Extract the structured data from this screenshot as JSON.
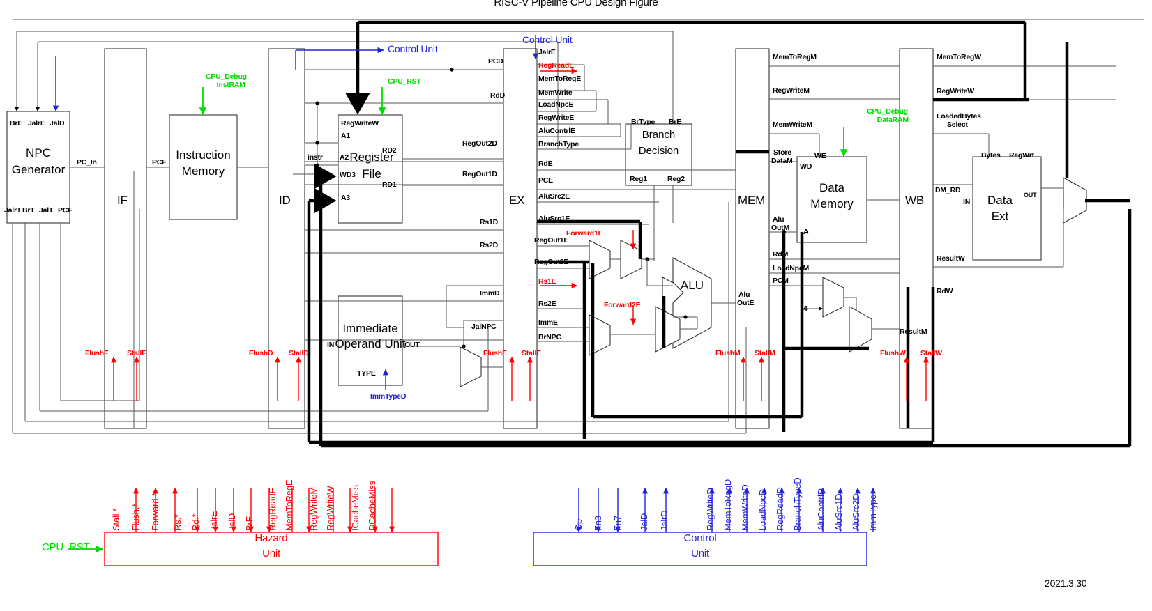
{
  "figure": {
    "title": "RISC-V Pipeline CPU Design Figure",
    "date": "2021.3.30"
  },
  "colors": {
    "black": "#000000",
    "red": "#ff0000",
    "blue": "#2222dd",
    "green": "#00dd00"
  },
  "stages": [
    {
      "name": "IF",
      "label": "IF"
    },
    {
      "name": "ID",
      "label": "ID"
    },
    {
      "name": "EX",
      "label": "EX"
    },
    {
      "name": "MEM",
      "label": "MEM"
    },
    {
      "name": "WB",
      "label": "WB"
    }
  ],
  "blocks": {
    "npc": {
      "line1": "NPC",
      "line2": "Generator"
    },
    "imem": {
      "line1": "Instruction",
      "line2": "Memory"
    },
    "regfile": {
      "line1": "Register",
      "line2": "File"
    },
    "imm": {
      "line1": "Immediate",
      "line2": "Operand Unit"
    },
    "branch": {
      "line1": "Branch",
      "line2": "Decision"
    },
    "alu": {
      "label": "ALU"
    },
    "dmem": {
      "line1": "Data",
      "line2": "Memory"
    },
    "dataext": {
      "line1": "Data",
      "line2": "Ext"
    },
    "hazard": {
      "line1": "Hazard",
      "line2": "Unit"
    },
    "control": {
      "line1": "Control",
      "line2": "Unit"
    }
  },
  "ports": {
    "npc_in": [
      "BrE",
      "JalrE",
      "JalD"
    ],
    "npc_out": [
      "JalrT",
      "BrT",
      "JalT",
      "PCF"
    ],
    "npc_pc_in": "PC_In",
    "if_pcf": "PCF",
    "regfile": {
      "regwritew": "RegWriteW",
      "a1": "A1",
      "a2": "A2",
      "wd3": "WD3",
      "a3": "A3",
      "rd1": "RD1",
      "rd2": "RD2"
    },
    "imm_in": "IN",
    "imm_out": "OUT",
    "imm_type_port": "TYPE",
    "branch": {
      "brtype": "BrType",
      "bre": "BrE",
      "reg1": "Reg1",
      "reg2": "Reg2"
    },
    "dmem": {
      "we": "WE",
      "wd": "WD",
      "a": "A"
    },
    "dataext": {
      "bytes": "Bytes",
      "regwrt": "RegWrt",
      "in": "IN",
      "out": "OUT"
    },
    "instr": "instr",
    "four": "4"
  },
  "signals": {
    "id_bus": [
      "PCD",
      "RdD",
      "RegOut2D",
      "RegOut1D",
      "Rs1D",
      "Rs2D",
      "ImmD",
      "JalNPC"
    ],
    "ex_bus": [
      "JalrE",
      "MemToRegE",
      "MemWrite",
      "LoadNpcE",
      "RegWriteE",
      "AluContrlE",
      "BranchType",
      "RdE",
      "PCE",
      "AluSrc2E",
      "AluSrc1E",
      "RegOut1E",
      "RegOut2E",
      "Rs2E",
      "ImmE",
      "BrNPC"
    ],
    "mem_bus": [
      "MemToRegM",
      "RegWriteM",
      "MemWriteM",
      "StoreDataM",
      "AluOutM",
      "RdM",
      "LoadNpcM",
      "PCM",
      "AluOutE"
    ],
    "wb_bus": [
      "MemToRegW",
      "RegWriteW",
      "LoadedBytesSelect",
      "DM_RD",
      "ResultW",
      "RdW",
      "ResultM"
    ],
    "store_data_m_l1": "Store",
    "store_data_m_l2": "DataM",
    "alu_out_m_l1": "Alu",
    "alu_out_m_l2": "OutM",
    "alu_out_e_l1": "Alu",
    "alu_out_e_l2": "OutE",
    "loaded_bytes_l1": "LoadedBytes",
    "loaded_bytes_l2": "Select"
  },
  "red_signals": {
    "forward1e": "Forward1E",
    "forward2e": "Forward2E",
    "regreade": "RegReadE",
    "rs1e": "Rs1E",
    "flush": [
      "FlushF",
      "FlushD",
      "FlushE",
      "FlushM",
      "FlushW"
    ],
    "stall": [
      "StallF",
      "StallD",
      "StallE",
      "StallM",
      "StallW"
    ]
  },
  "blue_signals": {
    "control_unit_top_left": "Control Unit",
    "control_unit_top_ex": "Control Unit",
    "immtyped": "ImmTypeD"
  },
  "green_signals": {
    "debug_instram_l1": "CPU_Debug",
    "debug_instram_l2": "_InstRAM",
    "cpu_rst": "CPU_RST",
    "debug_dataram_l1": "CPU_Debug",
    "debug_dataram_l2": "_DataRAM",
    "cpu_rst_hazard": "CPU_RST"
  },
  "hazard_unit": {
    "title_l1": "Hazard",
    "title_l2": "Unit",
    "reset": "CPU_RST",
    "outputs": [
      "Stall.*",
      "Flush.*",
      "Forward.*"
    ],
    "inputs": [
      "Rs.*",
      "Rd.*",
      "JalrE",
      "JalD",
      "BrE",
      "RegReadE",
      "MemToRegE",
      "RegWriteM",
      "RegWriteW",
      "ICacheMiss",
      "DCacheMiss"
    ]
  },
  "control_unit": {
    "title_l1": "Control",
    "title_l2": "Unit",
    "inputs": [
      "Op",
      "Fn3",
      "Fn7"
    ],
    "outputs": [
      "JalD",
      "JalrD",
      "RegWriteD",
      "MemToRegD",
      "MemWriteD",
      "LoadNpcD",
      "RegReadD",
      "BranchTypeD",
      "AluContrlD",
      "AluSrc1D",
      "AluSrc2D",
      "ImmType"
    ]
  }
}
